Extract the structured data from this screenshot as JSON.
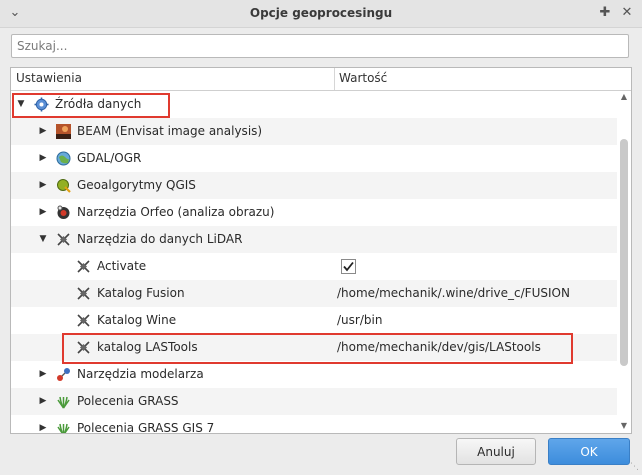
{
  "window": {
    "title": "Opcje geoprocesingu"
  },
  "search": {
    "placeholder": "Szukaj..."
  },
  "tree": {
    "header": {
      "col_settings": "Ustawienia",
      "col_value": "Wartość"
    },
    "rows": [
      {
        "label": "Źródła danych",
        "value": "",
        "expanded": true,
        "icon": "gear-icon"
      },
      {
        "label": "BEAM (Envisat image analysis)",
        "value": "",
        "expanded": false,
        "icon": "beam-icon"
      },
      {
        "label": "GDAL/OGR",
        "value": "",
        "expanded": false,
        "icon": "gdal-icon"
      },
      {
        "label": "Geoalgorytmy QGIS",
        "value": "",
        "expanded": false,
        "icon": "qgis-icon"
      },
      {
        "label": "Narzędzia Orfeo (analiza obrazu)",
        "value": "",
        "expanded": false,
        "icon": "orfeo-icon"
      },
      {
        "label": "Narzędzia do danych LiDAR",
        "value": "",
        "expanded": true,
        "icon": "lidar-icon"
      },
      {
        "label": "Activate",
        "value": "",
        "checked": true,
        "icon": "lidar-icon"
      },
      {
        "label": "Katalog Fusion",
        "value": "/home/mechanik/.wine/drive_c/FUSION",
        "icon": "lidar-icon"
      },
      {
        "label": "Katalog Wine",
        "value": "/usr/bin",
        "icon": "lidar-icon"
      },
      {
        "label": "katalog LASTools",
        "value": "/home/mechanik/dev/gis/LAStools",
        "icon": "lidar-icon"
      },
      {
        "label": "Narzędzia modelarza",
        "value": "",
        "expanded": false,
        "icon": "model-icon"
      },
      {
        "label": "Polecenia GRASS",
        "value": "",
        "expanded": false,
        "icon": "grass-icon"
      },
      {
        "label": "Polecenia GRASS GIS 7",
        "value": "",
        "expanded": false,
        "icon": "grass-icon"
      }
    ]
  },
  "buttons": {
    "cancel": "Anuluj",
    "ok": "OK"
  },
  "colors": {
    "highlight": "#e03a2f",
    "ok_button": "#3d8ddc"
  }
}
